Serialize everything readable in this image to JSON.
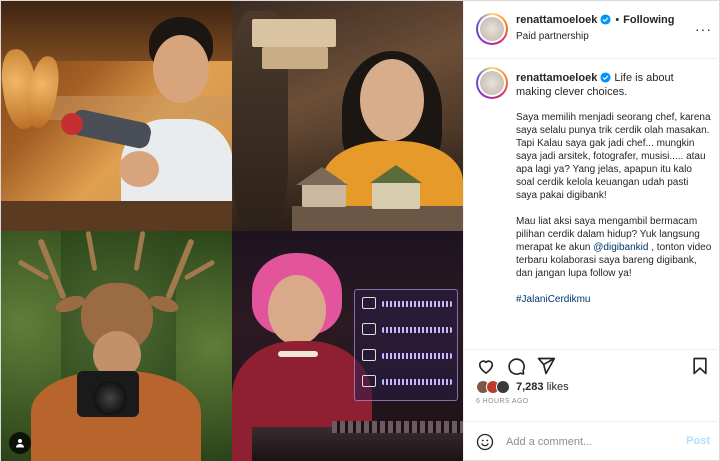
{
  "header": {
    "username": "renattamoeloek",
    "separator": "•",
    "follow_label": "Following",
    "subtitle": "Paid partnership",
    "more": "···"
  },
  "caption": {
    "username": "renattamoeloek",
    "headline": "Life is about making clever choices.",
    "paragraph1": "Saya memilih menjadi seorang chef, karena saya selalu punya trik cerdik olah masakan. Tapi Kalau saya gak jadi chef... mungkin saya jadi arsitek, fotografer, musisi..... atau apa lagi ya? Yang jelas, apapun itu kalo soal cerdik kelola keuangan udah pasti saya pakai digibank!",
    "paragraph2_part1": "Mau liat aksi saya mengambil bermacam pilihan cerdik dalam hidup? Yuk langsung merapat ke akun ",
    "paragraph2_mention": "@digibankid",
    "paragraph2_part2": " , tonton video terbaru kolaborasi saya bareng digibank, dan jangan lupa follow ya!",
    "hashtag": "#JalaniCerdikmu"
  },
  "engagement": {
    "likes_count": "7,283",
    "likes_word": "likes",
    "timestamp": "6 HOURS AGO"
  },
  "comment": {
    "placeholder": "Add a comment...",
    "post_label": "Post"
  },
  "icons": {
    "like": "heart-icon",
    "comment": "comment-icon",
    "share": "share-icon",
    "save": "bookmark-icon",
    "emoji": "emoji-icon",
    "verified": "verified-badge-icon",
    "tag": "user-tag-icon"
  },
  "colors": {
    "verified": "#0095f6",
    "link": "#00376b",
    "post_disabled": "#b2dffc",
    "muted": "#8e8e8e"
  }
}
